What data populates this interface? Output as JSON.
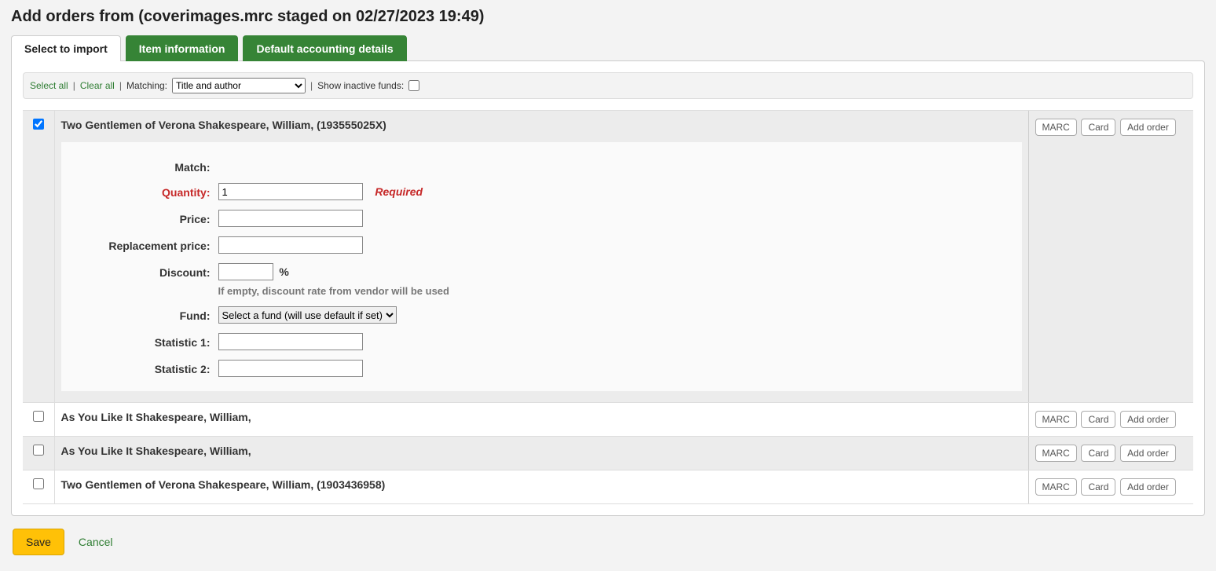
{
  "page_title": "Add orders from (coverimages.mrc staged on 02/27/2023 19:49)",
  "tabs": [
    {
      "label": "Select to import",
      "active": true
    },
    {
      "label": "Item information",
      "active": false
    },
    {
      "label": "Default accounting details",
      "active": false
    }
  ],
  "toolbar": {
    "select_all": "Select all",
    "clear_all": "Clear all",
    "matching_label": "Matching:",
    "matching_options": [
      "Title and author"
    ],
    "matching_value": "Title and author",
    "show_inactive_label": "Show inactive funds:"
  },
  "action_buttons": {
    "marc": "MARC",
    "card": "Card",
    "add_order": "Add order"
  },
  "records": [
    {
      "checked": true,
      "title": "Two Gentlemen of Verona Shakespeare, William, (193555025X)",
      "expanded": true,
      "shade": "grey"
    },
    {
      "checked": false,
      "title": "As You Like It Shakespeare, William,",
      "expanded": false,
      "shade": "white"
    },
    {
      "checked": false,
      "title": "As You Like It Shakespeare, William,",
      "expanded": false,
      "shade": "grey"
    },
    {
      "checked": false,
      "title": "Two Gentlemen of Verona Shakespeare, William, (1903436958)",
      "expanded": false,
      "shade": "white"
    }
  ],
  "detail_form": {
    "match_label": "Match:",
    "quantity_label": "Quantity:",
    "quantity_value": "1",
    "required_text": "Required",
    "price_label": "Price:",
    "replacement_label": "Replacement price:",
    "discount_label": "Discount:",
    "discount_unit": "%",
    "discount_hint": "If empty, discount rate from vendor will be used",
    "fund_label": "Fund:",
    "fund_options": [
      "Select a fund (will use default if set)"
    ],
    "fund_value": "Select a fund (will use default if set)",
    "stat1_label": "Statistic 1:",
    "stat2_label": "Statistic 2:"
  },
  "footer": {
    "save": "Save",
    "cancel": "Cancel"
  }
}
